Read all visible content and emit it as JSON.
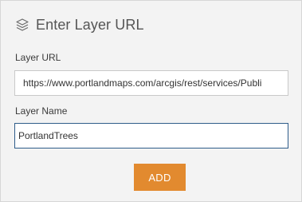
{
  "dialog": {
    "title": "Enter Layer URL",
    "title_icon": "layers-icon"
  },
  "form": {
    "layer_url_label": "Layer URL",
    "layer_url_value": "https://www.portlandmaps.com/arcgis/rest/services/Publi",
    "layer_name_label": "Layer Name",
    "layer_name_value": "PortlandTrees"
  },
  "actions": {
    "add_label": "ADD"
  },
  "colors": {
    "accent": "#e28a2f",
    "focus_border": "#2f5d8a",
    "panel_background": "#f3f3f3"
  }
}
